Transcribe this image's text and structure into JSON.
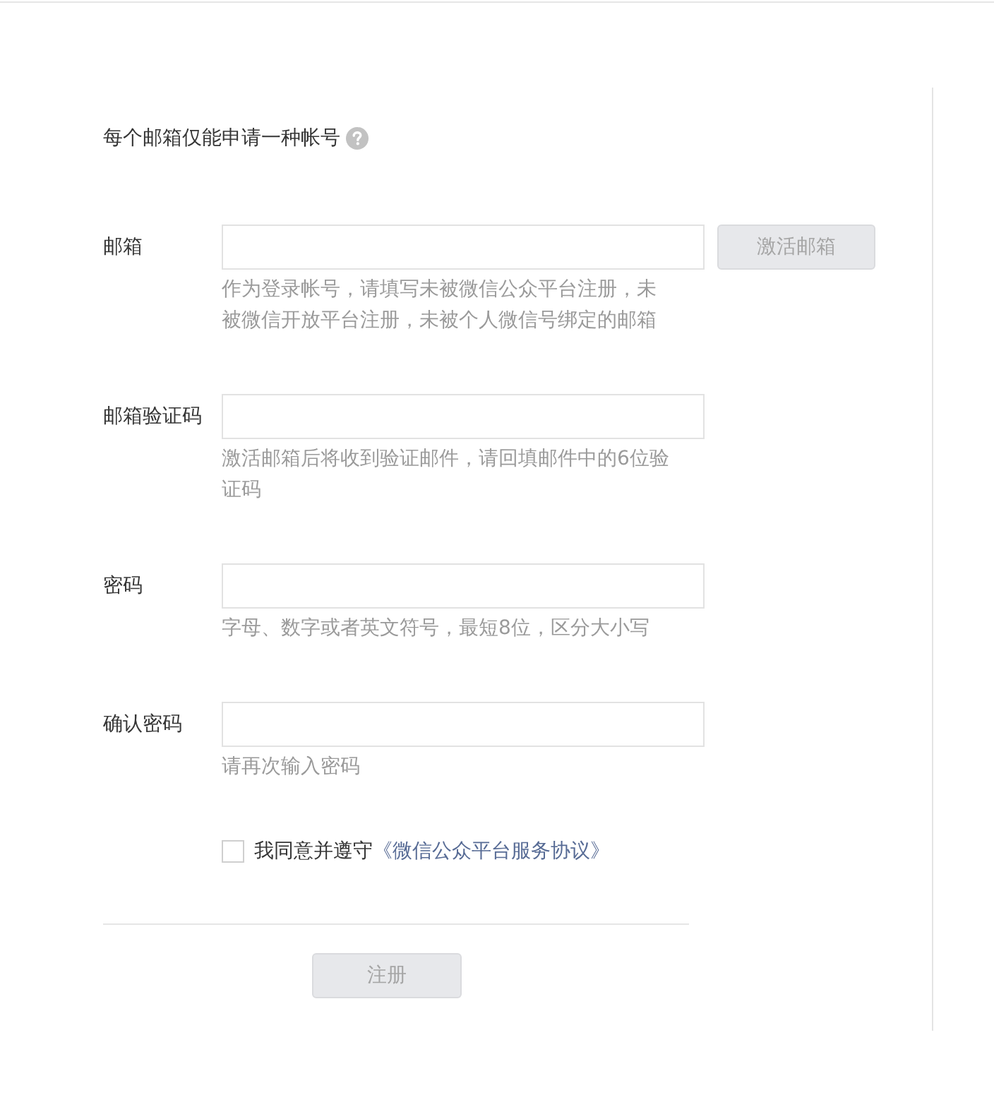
{
  "notice": {
    "text": "每个邮箱仅能申请一种帐号"
  },
  "fields": [
    {
      "label": "邮箱",
      "hint": "作为登录帐号，请填写未被微信公众平台注册，未被微信开放平台注册，未被个人微信号绑定的邮箱",
      "button": {
        "label": "激活邮箱",
        "disabled": true
      }
    },
    {
      "label": "邮箱验证码",
      "hint": "激活邮箱后将收到验证邮件，请回填邮件中的6位验证码"
    },
    {
      "label": "密码",
      "hint": "字母、数字或者英文符号，最短8位，区分大小写"
    },
    {
      "label": "确认密码",
      "hint": "请再次输入密码"
    }
  ],
  "agreement": {
    "checked": false,
    "text": "我同意并遵守",
    "link": "《微信公众平台服务协议》"
  },
  "submit": {
    "label": "注册",
    "disabled": true
  }
}
